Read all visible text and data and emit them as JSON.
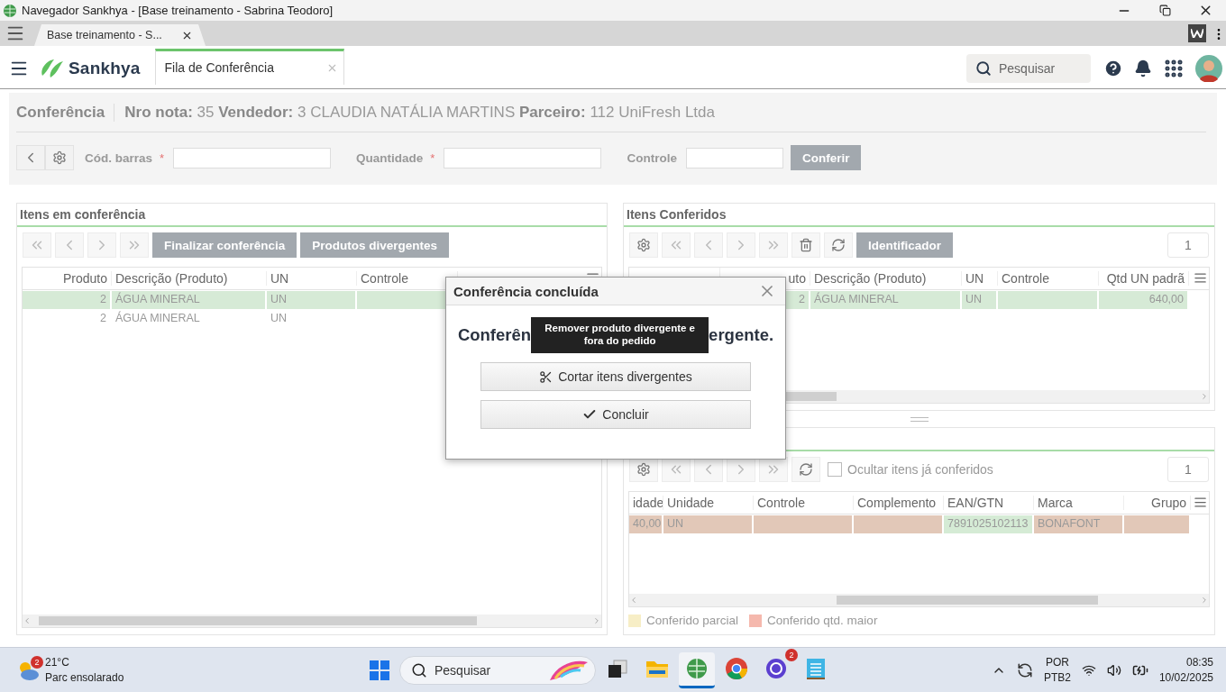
{
  "window": {
    "title": "Navegador Sankhya - [Base treinamento - Sabrina Teodoro]"
  },
  "browser_tab": {
    "label": "Base treinamento - S..."
  },
  "app_header": {
    "logo": "Sankhya",
    "tab": {
      "label": "Fila de Conferência",
      "selected": true
    },
    "search": {
      "placeholder": "Pesquisar"
    }
  },
  "conference": {
    "title": "Conferência",
    "info": "**Nro nota:** 35 **Vendedor:** 3 CLAUDIA NATÁLIA MARTINS **Parceiro:** 112 UniFresh Ltda",
    "fields": [
      {
        "label": "Cód. barras",
        "required_mark": "*"
      },
      {
        "label": "Quantidade",
        "required_mark": "*"
      },
      {
        "label": "Controle"
      }
    ],
    "submit": "Conferir"
  },
  "items_in_conference": {
    "title": "Itens em conferência",
    "buttons": [
      "Finalizar conferência",
      "Produtos divergentes"
    ],
    "table": {
      "columns": [
        {
          "label": "Produto",
          "kind": "number"
        },
        {
          "label": "Descrição (Produto)",
          "kind": "text"
        },
        {
          "label": "UN",
          "kind": "text"
        },
        {
          "label": "Controle",
          "kind": "text"
        },
        {
          "kind": "text"
        },
        {
          "kind": "text"
        }
      ],
      "rows": [
        {
          "selected": true,
          "cells": [
            "2",
            "ÁGUA MINERAL",
            "UN"
          ]
        },
        {
          "selected": false,
          "cells": [
            "2",
            "ÁGUA MINERAL",
            "UN"
          ]
        }
      ]
    }
  },
  "checked_items": {
    "title": "Itens Conferidos",
    "button": "Identificador",
    "page": "1",
    "table": {
      "columns": [
        {
          "label": "uto",
          "kind": "number"
        },
        {
          "label": "Descrição (Produto)",
          "kind": "text"
        },
        {
          "label": "UN",
          "kind": "text"
        },
        {
          "label": "Controle",
          "kind": "text"
        },
        {
          "label": "Qtd UN padrã",
          "kind": "number"
        }
      ],
      "rows": [
        {
          "selected": true,
          "cells": [
            "2",
            "ÁGUA MINERAL",
            "UN",
            null,
            "640,00"
          ]
        }
      ]
    }
  },
  "items_panel": {
    "checkbox": {
      "label": "Ocultar itens já conferidos",
      "checked": false
    },
    "page": "1",
    "table": {
      "columns": [
        {
          "label": "idade",
          "kind": "number"
        },
        {
          "label": "Unidade",
          "kind": "text"
        },
        {
          "label": "Controle",
          "kind": "text"
        },
        {
          "label": "Complemento",
          "kind": "text"
        },
        {
          "label": "EAN/GTN",
          "kind": "text"
        },
        {
          "label": "Marca",
          "kind": "text"
        },
        {
          "label": "Grupo",
          "kind": "number"
        }
      ],
      "rows": [
        {
          "color": "#e2c8b8",
          "cells": [
            {
              "text": "40,00",
              "matched": false
            },
            {
              "text": "UN",
              "matched": false
            },
            {
              "matched": false
            },
            {
              "matched": false
            },
            {
              "text": "7891025102113",
              "matched": true
            },
            {
              "text": "BONAFONT",
              "matched": false
            },
            {
              "matched": false
            }
          ]
        }
      ]
    },
    "legend": [
      {
        "label": "Conferido parcial",
        "color": "#f7eec6"
      },
      {
        "label": "Conferido qtd. maior",
        "color": "#f5b8ad"
      }
    ]
  },
  "dialog": {
    "title": "Conferência concluída",
    "message_start": "Conferên",
    "message_end": "ergente.",
    "tooltip": "Remover produto divergente e fora do pedido",
    "buttons": [
      {
        "kind": "cut",
        "label": "Cortar itens divergentes"
      },
      {
        "kind": "confirm",
        "label": "Concluir"
      }
    ]
  },
  "taskbar": {
    "weather": {
      "badge": "2",
      "temperature": "21°C",
      "condition": "Parc ensolarado"
    },
    "search": {
      "placeholder": "Pesquisar"
    },
    "apps": [
      {
        "kind": "taskview",
        "selected": false
      },
      {
        "kind": "folder",
        "selected": false
      },
      {
        "kind": "sankhya",
        "selected": true
      },
      {
        "kind": "chrome",
        "selected": false
      },
      {
        "kind": "chat",
        "selected": false,
        "badge": "2"
      },
      {
        "kind": "notepad",
        "selected": false
      }
    ],
    "language": "POR",
    "layout": "PTB2",
    "time": "08:35",
    "date": "10/02/2025"
  }
}
